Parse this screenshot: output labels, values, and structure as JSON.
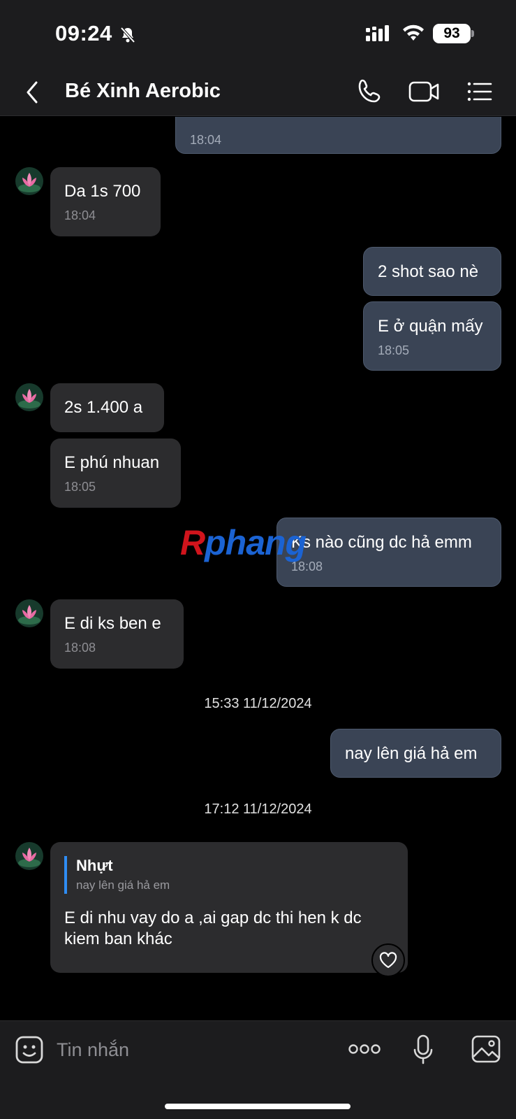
{
  "status": {
    "time": "09:24",
    "battery": "93"
  },
  "header": {
    "title": "Bé Xinh Aerobic"
  },
  "messages": {
    "m0_time": "18:04",
    "m1_text": "Da 1s 700",
    "m1_time": "18:04",
    "m2_text": "2 shot sao nè",
    "m3_text": "E ở quận mấy",
    "m3_time": "18:05",
    "m4_text": "2s 1.400 a",
    "m5_text": "E phú nhuan",
    "m5_time": "18:05",
    "m6_text": "Ks nào cũng dc hả emm",
    "m6_time": "18:08",
    "m7_text": "E di ks ben e",
    "m7_time": "18:08",
    "sep1": "15:33 11/12/2024",
    "m8_text": "nay lên giá hả em",
    "sep2": "17:12 11/12/2024",
    "m9_quote_author": "Nhựt",
    "m9_quote_text": "nay lên giá hả em",
    "m9_text": "E di nhu vay do a ,ai gap dc thi hen k dc kiem ban khác"
  },
  "watermark": {
    "r": "R",
    "rest": "phang"
  },
  "input": {
    "placeholder": "Tin nhắn"
  }
}
